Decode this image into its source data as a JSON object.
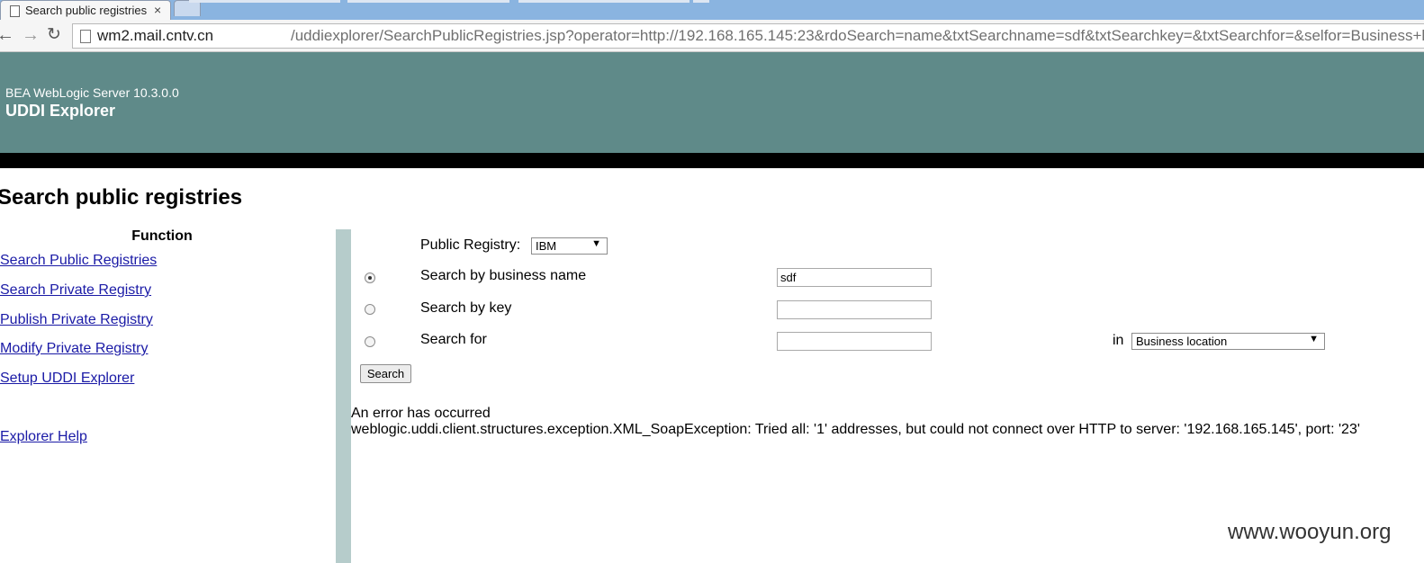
{
  "browser": {
    "tab_title": "Search public registries",
    "tab_close": "×",
    "url_host": "wm2.mail.cntv.cn",
    "url_path": "/uddiexplorer/SearchPublicRegistries.jsp?operator=http://192.168.165.145:23&rdoSearch=name&txtSearchname=sdf&txtSearchkey=&txtSearchfor=&selfor=Business+location"
  },
  "banner": {
    "product": "BEA WebLogic Server 10.3.0.0",
    "title": "UDDI Explorer",
    "color": "#5f8a89"
  },
  "page": {
    "title": "Search public registries"
  },
  "sidebar": {
    "header": "Function",
    "items": [
      {
        "label": "Search Public Registries"
      },
      {
        "label": "Search Private Registry"
      },
      {
        "label": "Publish Private Registry"
      },
      {
        "label": "Modify Private Registry"
      },
      {
        "label": "Setup UDDI Explorer"
      },
      {
        "label": "Explorer Help"
      }
    ]
  },
  "form": {
    "registry_label": "Public Registry:",
    "registry_value": "IBM",
    "options": [
      {
        "label": "Search by business name",
        "value": "sdf",
        "selected": true
      },
      {
        "label": "Search by key",
        "value": "",
        "selected": false
      },
      {
        "label": "Search for",
        "value": "",
        "selected": false
      }
    ],
    "in_label": "in",
    "search_for_scope": "Business location",
    "search_button": "Search"
  },
  "error": {
    "title": "An error has occurred",
    "message": "weblogic.uddi.client.structures.exception.XML_SoapException: Tried all: '1' addresses, but could not connect over HTTP to server: '192.168.165.145', port: '23'"
  },
  "watermark": "www.wooyun.org"
}
